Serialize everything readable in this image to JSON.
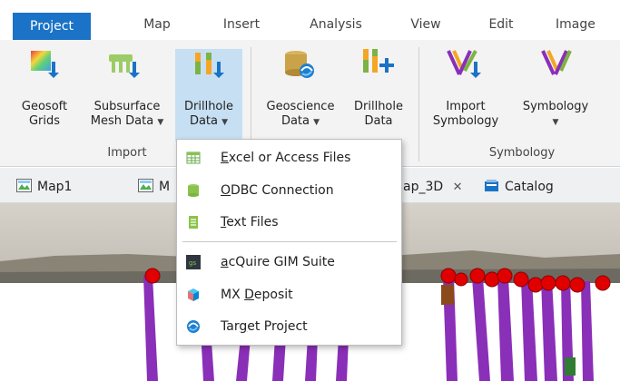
{
  "menu": {
    "tabs": [
      {
        "label": "Project",
        "active": true
      },
      {
        "label": "Map"
      },
      {
        "label": "Insert"
      },
      {
        "label": "Analysis"
      },
      {
        "label": "View"
      },
      {
        "label": "Edit"
      },
      {
        "label": "Image"
      }
    ]
  },
  "ribbon": {
    "groups": {
      "import": "Import",
      "symbology": "Symbology"
    },
    "buttons": {
      "geosoft_grids": {
        "line1": "Geosoft",
        "line2": "Grids"
      },
      "subsurface_mesh": {
        "line1": "Subsurface",
        "line2": "Mesh Data"
      },
      "drillhole_data": {
        "line1": "Drillhole",
        "line2": "Data"
      },
      "geoscience_data": {
        "line1": "Geoscience",
        "line2": "Data"
      },
      "drillhole_data2": {
        "line1": "Drillhole",
        "line2": "Data"
      },
      "import_symbology": {
        "line1": "Import",
        "line2": "Symbology"
      },
      "symbology": {
        "line1": "Symbology",
        "line2": ""
      }
    }
  },
  "view_tabs": {
    "map1": "Map1",
    "map2": "M",
    "map3d": "ap_3D",
    "catalog": "Catalog"
  },
  "dropdown": {
    "items": [
      {
        "pre": "",
        "u": "E",
        "post": "xcel or Access Files"
      },
      {
        "pre": "",
        "u": "O",
        "post": "DBC Connection"
      },
      {
        "pre": "",
        "u": "T",
        "post": "ext Files"
      },
      {
        "pre": "",
        "u": "a",
        "post": "cQuire GIM Suite"
      },
      {
        "pre": "MX ",
        "u": "D",
        "post": "eposit"
      },
      {
        "pre": "Tar",
        "u": "g",
        "post": "et Project"
      }
    ]
  },
  "colors": {
    "accent": "#1a73c6",
    "ribbon_bg": "#f3f3f3",
    "selected_bg": "#c7dff3",
    "drillhole": "#8a2fb8",
    "marker": "#e10000"
  }
}
